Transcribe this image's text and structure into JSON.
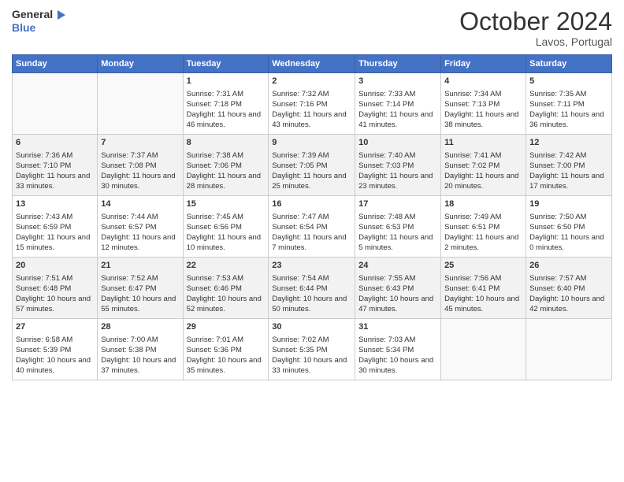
{
  "header": {
    "logo_line1": "General",
    "logo_line2": "Blue",
    "month": "October 2024",
    "location": "Lavos, Portugal"
  },
  "weekdays": [
    "Sunday",
    "Monday",
    "Tuesday",
    "Wednesday",
    "Thursday",
    "Friday",
    "Saturday"
  ],
  "weeks": [
    [
      {
        "day": "",
        "info": ""
      },
      {
        "day": "",
        "info": ""
      },
      {
        "day": "1",
        "info": "Sunrise: 7:31 AM\nSunset: 7:18 PM\nDaylight: 11 hours and 46 minutes."
      },
      {
        "day": "2",
        "info": "Sunrise: 7:32 AM\nSunset: 7:16 PM\nDaylight: 11 hours and 43 minutes."
      },
      {
        "day": "3",
        "info": "Sunrise: 7:33 AM\nSunset: 7:14 PM\nDaylight: 11 hours and 41 minutes."
      },
      {
        "day": "4",
        "info": "Sunrise: 7:34 AM\nSunset: 7:13 PM\nDaylight: 11 hours and 38 minutes."
      },
      {
        "day": "5",
        "info": "Sunrise: 7:35 AM\nSunset: 7:11 PM\nDaylight: 11 hours and 36 minutes."
      }
    ],
    [
      {
        "day": "6",
        "info": "Sunrise: 7:36 AM\nSunset: 7:10 PM\nDaylight: 11 hours and 33 minutes."
      },
      {
        "day": "7",
        "info": "Sunrise: 7:37 AM\nSunset: 7:08 PM\nDaylight: 11 hours and 30 minutes."
      },
      {
        "day": "8",
        "info": "Sunrise: 7:38 AM\nSunset: 7:06 PM\nDaylight: 11 hours and 28 minutes."
      },
      {
        "day": "9",
        "info": "Sunrise: 7:39 AM\nSunset: 7:05 PM\nDaylight: 11 hours and 25 minutes."
      },
      {
        "day": "10",
        "info": "Sunrise: 7:40 AM\nSunset: 7:03 PM\nDaylight: 11 hours and 23 minutes."
      },
      {
        "day": "11",
        "info": "Sunrise: 7:41 AM\nSunset: 7:02 PM\nDaylight: 11 hours and 20 minutes."
      },
      {
        "day": "12",
        "info": "Sunrise: 7:42 AM\nSunset: 7:00 PM\nDaylight: 11 hours and 17 minutes."
      }
    ],
    [
      {
        "day": "13",
        "info": "Sunrise: 7:43 AM\nSunset: 6:59 PM\nDaylight: 11 hours and 15 minutes."
      },
      {
        "day": "14",
        "info": "Sunrise: 7:44 AM\nSunset: 6:57 PM\nDaylight: 11 hours and 12 minutes."
      },
      {
        "day": "15",
        "info": "Sunrise: 7:45 AM\nSunset: 6:56 PM\nDaylight: 11 hours and 10 minutes."
      },
      {
        "day": "16",
        "info": "Sunrise: 7:47 AM\nSunset: 6:54 PM\nDaylight: 11 hours and 7 minutes."
      },
      {
        "day": "17",
        "info": "Sunrise: 7:48 AM\nSunset: 6:53 PM\nDaylight: 11 hours and 5 minutes."
      },
      {
        "day": "18",
        "info": "Sunrise: 7:49 AM\nSunset: 6:51 PM\nDaylight: 11 hours and 2 minutes."
      },
      {
        "day": "19",
        "info": "Sunrise: 7:50 AM\nSunset: 6:50 PM\nDaylight: 11 hours and 0 minutes."
      }
    ],
    [
      {
        "day": "20",
        "info": "Sunrise: 7:51 AM\nSunset: 6:48 PM\nDaylight: 10 hours and 57 minutes."
      },
      {
        "day": "21",
        "info": "Sunrise: 7:52 AM\nSunset: 6:47 PM\nDaylight: 10 hours and 55 minutes."
      },
      {
        "day": "22",
        "info": "Sunrise: 7:53 AM\nSunset: 6:46 PM\nDaylight: 10 hours and 52 minutes."
      },
      {
        "day": "23",
        "info": "Sunrise: 7:54 AM\nSunset: 6:44 PM\nDaylight: 10 hours and 50 minutes."
      },
      {
        "day": "24",
        "info": "Sunrise: 7:55 AM\nSunset: 6:43 PM\nDaylight: 10 hours and 47 minutes."
      },
      {
        "day": "25",
        "info": "Sunrise: 7:56 AM\nSunset: 6:41 PM\nDaylight: 10 hours and 45 minutes."
      },
      {
        "day": "26",
        "info": "Sunrise: 7:57 AM\nSunset: 6:40 PM\nDaylight: 10 hours and 42 minutes."
      }
    ],
    [
      {
        "day": "27",
        "info": "Sunrise: 6:58 AM\nSunset: 5:39 PM\nDaylight: 10 hours and 40 minutes."
      },
      {
        "day": "28",
        "info": "Sunrise: 7:00 AM\nSunset: 5:38 PM\nDaylight: 10 hours and 37 minutes."
      },
      {
        "day": "29",
        "info": "Sunrise: 7:01 AM\nSunset: 5:36 PM\nDaylight: 10 hours and 35 minutes."
      },
      {
        "day": "30",
        "info": "Sunrise: 7:02 AM\nSunset: 5:35 PM\nDaylight: 10 hours and 33 minutes."
      },
      {
        "day": "31",
        "info": "Sunrise: 7:03 AM\nSunset: 5:34 PM\nDaylight: 10 hours and 30 minutes."
      },
      {
        "day": "",
        "info": ""
      },
      {
        "day": "",
        "info": ""
      }
    ]
  ]
}
